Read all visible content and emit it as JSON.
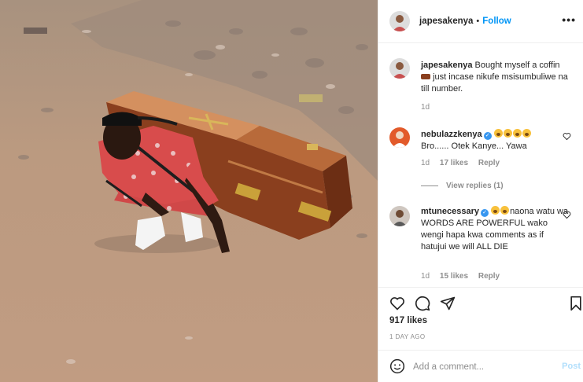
{
  "post": {
    "username": "japesakenya",
    "separator": "•",
    "follow_label": "Follow",
    "more_label": "•••",
    "caption_text": "Bought myself a coffin",
    "caption_rest": "just incase nikufe msisumbuliwe na till number.",
    "caption_time": "1d"
  },
  "comments": [
    {
      "username": "nebulazzkenya",
      "text": "Bro...... Otek Kanye... Yawa",
      "time": "1d",
      "likes": "17 likes",
      "reply_label": "Reply",
      "view_replies": "View replies (1)"
    },
    {
      "username": "mtunecessary",
      "text": "naona watu wa WORDS ARE POWERFUL wako wengi hapa kwa comments as if hatujui we will ALL DIE",
      "time": "1d",
      "likes": "15 likes",
      "reply_label": "Reply"
    }
  ],
  "footer": {
    "likes": "917 likes",
    "date": "1 DAY AGO",
    "add_comment_placeholder": "Add a comment...",
    "post_label": "Post"
  },
  "icons": {
    "like": "heart-icon",
    "comment": "comment-icon",
    "share": "share-icon",
    "save": "bookmark-icon",
    "emoji": "emoji-icon"
  },
  "colors": {
    "accent": "#0095f6",
    "muted": "#8e8e8e",
    "post_disabled": "#b2dffc",
    "verified": "#3897f0"
  }
}
